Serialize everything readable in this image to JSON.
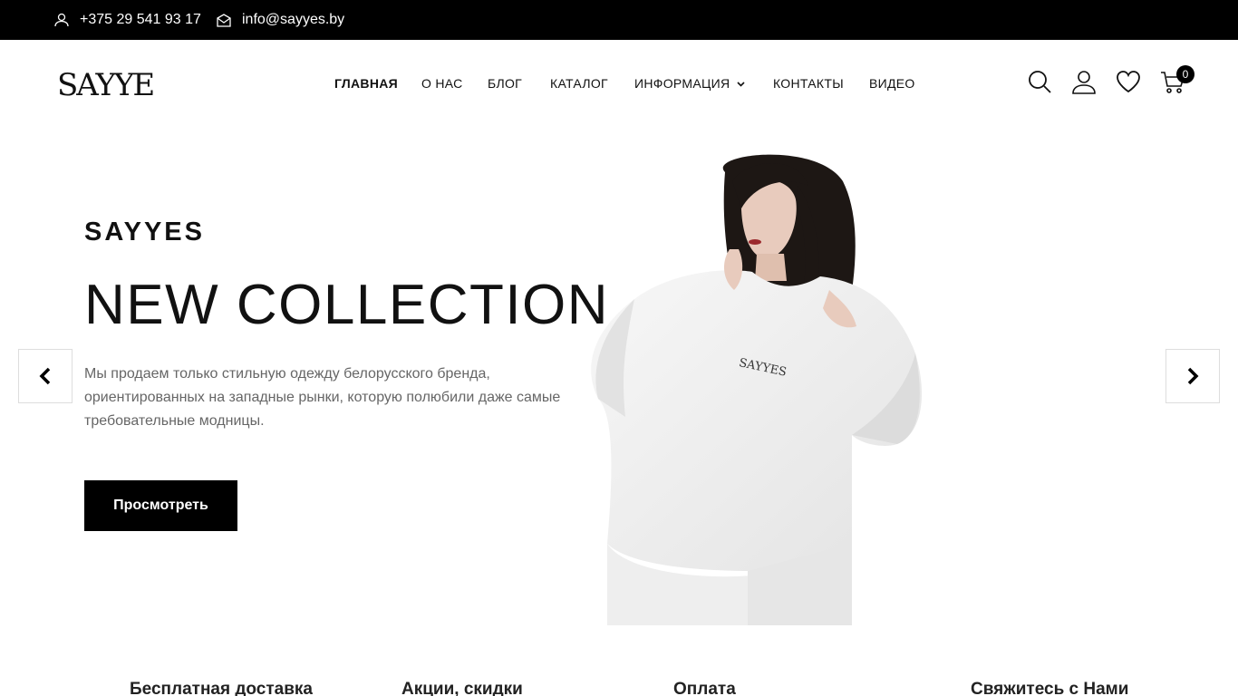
{
  "topbar": {
    "phone": "+375 29 541 93 17",
    "email": "info@sayyes.by",
    "phone_icon": "user-icon",
    "email_icon": "mail-icon"
  },
  "header": {
    "logo_text": "SAYYES",
    "nav": {
      "home": "ГЛАВНАЯ",
      "about": "О НАС",
      "blog": "БЛОГ",
      "catalog": "КАТАЛОГ",
      "info": "ИНФОРМАЦИЯ",
      "contacts": "КОНТАКТЫ",
      "video": "ВИДЕО"
    },
    "cart_count": "0",
    "icons": [
      "search-icon",
      "user-icon",
      "heart-icon",
      "cart-icon"
    ]
  },
  "hero": {
    "brand": "SAYYES",
    "title": "NEW COLLECTION",
    "text": "Мы продаем только стильную одежду белорусского бренда, ориентированных на западные рынки, которую полюбили даже самые требовательные модницы.",
    "button": "Просмотреть",
    "image_logo": "SAYYES"
  },
  "features": [
    {
      "title": "Бесплатная доставка",
      "icon": "truck-icon"
    },
    {
      "title": "Акции, скидки",
      "icon": "refresh-icon"
    },
    {
      "title": "Оплата",
      "icon": "card-icon"
    },
    {
      "title": "Свяжитесь с Нами",
      "icon": "phone-icon"
    }
  ],
  "colors": {
    "topbar_bg": "#000000",
    "accent": "#000000",
    "text_muted": "#666666"
  }
}
